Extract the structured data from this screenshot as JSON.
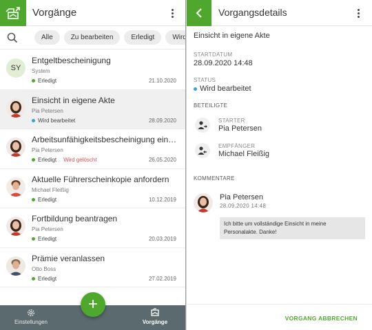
{
  "left": {
    "title": "Vorgänge",
    "filters": [
      "Alle",
      "Zu bearbeiten",
      "Erledigt",
      "Wird b"
    ],
    "items": [
      {
        "title": "Entgeltbescheinigung",
        "subtitle": "System",
        "status": "Erledigt",
        "status_color": "#4fa82d",
        "extra": "",
        "date": "21.10.2020",
        "avatar": "initials",
        "initials": "SY",
        "selected": false
      },
      {
        "title": "Einsicht in eigene Akte",
        "subtitle": "Pia Petersen",
        "status": "Wird bearbeitet",
        "status_color": "#3aa0d8",
        "extra": "",
        "date": "28.09.2020",
        "avatar": "woman",
        "initials": "",
        "selected": true
      },
      {
        "title": "Arbeitsunfähigkeitsbescheinigung einreich…",
        "subtitle": "Pia Petersen",
        "status": "Erledigt",
        "status_color": "#4fa82d",
        "extra": "Wird gelöscht",
        "date": "26.05.2020",
        "avatar": "woman",
        "initials": "",
        "selected": false
      },
      {
        "title": "Aktuelle Führerscheinkopie anfordern",
        "subtitle": "Michael Fleißig",
        "status": "Erledigt",
        "status_color": "#4fa82d",
        "extra": "",
        "date": "10.12.2019",
        "avatar": "man",
        "initials": "",
        "selected": false
      },
      {
        "title": "Fortbildung beantragen",
        "subtitle": "Pia Petersen",
        "status": "Erledigt",
        "status_color": "#4fa82d",
        "extra": "",
        "date": "20.03.2019",
        "avatar": "woman",
        "initials": "",
        "selected": false
      },
      {
        "title": "Prämie veranlassen",
        "subtitle": "Otto Boss",
        "status": "Erledigt",
        "status_color": "#4fa82d",
        "extra": "",
        "date": "27.02.2019",
        "avatar": "man2",
        "initials": "",
        "selected": false
      }
    ],
    "nav": {
      "settings": "Einstellungen",
      "processes": "Vorgänge"
    },
    "fab": "+"
  },
  "right": {
    "title": "Vorgangsdetails",
    "doc_title": "Einsicht in eigene Akte",
    "startdate_label": "STARTDATUM",
    "startdate": "28.09.2020 14:48",
    "status_label": "STATUS",
    "status": "Wird bearbeitet",
    "status_color": "#3aa0d8",
    "participants_label": "BETEILIGTE",
    "starter_label": "STARTER",
    "starter": "Pia Petersen",
    "recipient_label": "EMPFÄNGER",
    "recipient": "Michael Fleißig",
    "comments_label": "KOMMENTARE",
    "comment": {
      "author": "Pia Petersen",
      "time": "28.09.2020 14:48",
      "text": "Ich bitte um vollständige Einsicht in meine Personalakte. Danke!"
    },
    "cancel": "VORGANG ABBRECHEN"
  },
  "colors": {
    "accent": "#4fa82d",
    "bottom_nav": "#5a6a6f",
    "in_progress": "#3aa0d8",
    "deleting": "#d9534f"
  }
}
